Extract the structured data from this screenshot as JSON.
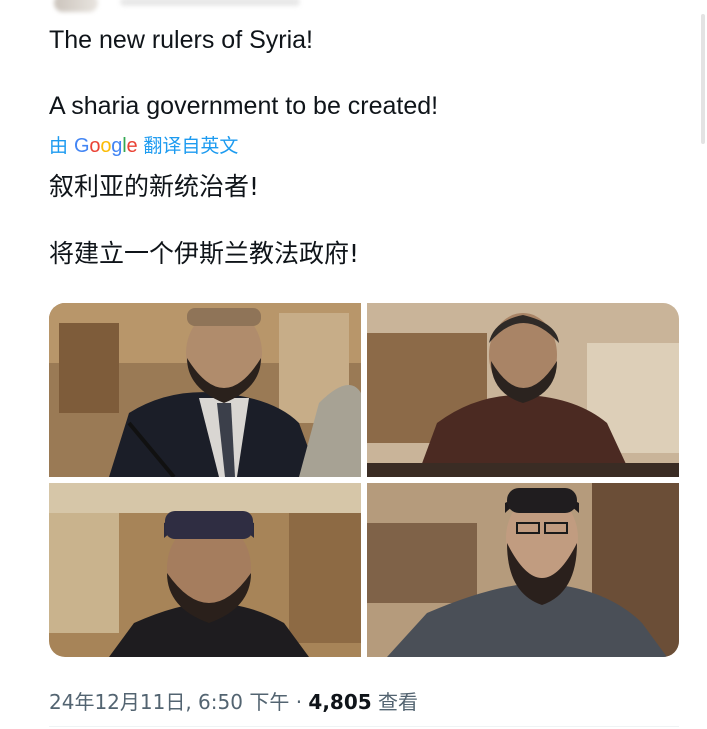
{
  "tweet": {
    "line1": "The new rulers of Syria!",
    "line2": "A sharia government to be created!",
    "translation": {
      "prefix": "由",
      "google": [
        "G",
        "o",
        "o",
        "g",
        "l",
        "e"
      ],
      "suffix": "翻译自英文"
    },
    "translated_line1": "叙利亚的新统治者!",
    "translated_line2": "将建立一个伊斯兰教法政府!",
    "meta": {
      "date_time": "24年12月11日, 6:50 下午",
      "separator": " · ",
      "views_count": "4,805",
      "views_label": " 查看"
    }
  },
  "media": [
    {
      "name": "photo-1"
    },
    {
      "name": "photo-2"
    },
    {
      "name": "photo-3"
    },
    {
      "name": "photo-4"
    }
  ],
  "colors": {
    "link_blue": "#1d9bf0",
    "text_primary": "#0f1419",
    "text_secondary": "#536471"
  }
}
